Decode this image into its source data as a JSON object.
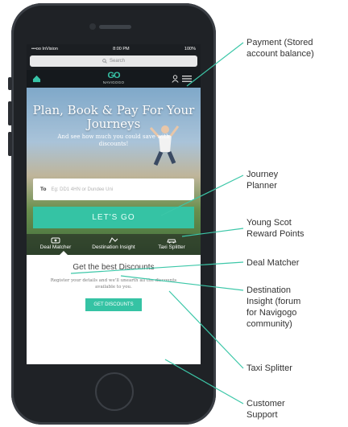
{
  "status": {
    "carrier": "•••oo InVision",
    "time": "8:00 PM",
    "battery": "100%"
  },
  "search": {
    "placeholder": "Search"
  },
  "header": {
    "logo_mark": "GO",
    "logo_text": "NAVIGOGO"
  },
  "hero": {
    "title": "Plan, Book & Pay For Your Journeys",
    "subtitle": "And see how much you could save with discounts!",
    "to_label": "To",
    "to_placeholder": "Eg: DD1 4HN or Dundee Uni",
    "go_label": "LET'S GO"
  },
  "features": [
    {
      "label": "Deal Matcher",
      "icon": "deal-icon"
    },
    {
      "label": "Destination Insight",
      "icon": "insight-icon"
    },
    {
      "label": "Taxi Splitter",
      "icon": "taxi-icon"
    }
  ],
  "cta": {
    "heading": "Get the best Discounts",
    "body": "Register your details and we'll unearth all the discounts available to you.",
    "button": "GET DISCOUNTS"
  },
  "annotations": [
    {
      "lines": [
        "Payment (Stored",
        "account balance)"
      ]
    },
    {
      "lines": [
        "Journey",
        "Planner"
      ]
    },
    {
      "lines": [
        "Young Scot",
        "Reward Points"
      ]
    },
    {
      "lines": [
        "Deal Matcher"
      ]
    },
    {
      "lines": [
        "Destination",
        "Insight (forum",
        "for Navigogo",
        "community)"
      ]
    },
    {
      "lines": [
        "Taxi Splitter"
      ]
    },
    {
      "lines": [
        "Customer",
        "Support"
      ]
    }
  ],
  "colors": {
    "accent": "#35c3a4",
    "line": "#3cc7a8",
    "phone": "#1f2226"
  }
}
